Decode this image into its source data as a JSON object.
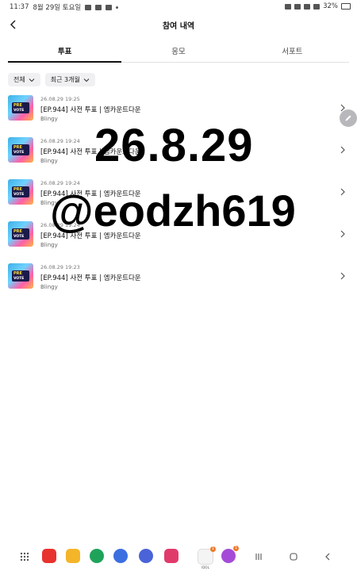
{
  "status_bar": {
    "time": "11:37",
    "date": "8월 29일 토요일",
    "battery": "32%"
  },
  "header": {
    "title": "참여 내역"
  },
  "tabs": [
    {
      "label": "투표",
      "active": true
    },
    {
      "label": "응모",
      "active": false
    },
    {
      "label": "서포트",
      "active": false
    }
  ],
  "filters": {
    "type": "전체",
    "period": "최근 3개월"
  },
  "items": [
    {
      "date": "26.08.29 19:25",
      "title": "[EP.944] 사전 투표 | 엠카운트다운",
      "source": "Blingy",
      "thumb_top": "PRE",
      "thumb_bottom": "VOTE"
    },
    {
      "date": "26.08.29 19:24",
      "title": "[EP.944] 사전 투표 | 엠카운트다운",
      "source": "Blingy",
      "thumb_top": "PRE",
      "thumb_bottom": "VOTE"
    },
    {
      "date": "26.08.29 19:24",
      "title": "[EP.944] 사전 투표 | 엠카운트다운",
      "source": "Blingy",
      "thumb_top": "PRE",
      "thumb_bottom": "VOTE"
    },
    {
      "date": "26.08.29 19:24",
      "title": "[EP.944] 사전 투표 | 엠카운트다운",
      "source": "Blingy",
      "thumb_top": "PRE",
      "thumb_bottom": "VOTE"
    },
    {
      "date": "26.08.29 19:23",
      "title": "[EP.944] 사전 투표 | 엠카운트다운",
      "source": "Blingy",
      "thumb_top": "PRE",
      "thumb_bottom": "VOTE"
    }
  ],
  "overlay": {
    "date": "26.8.29",
    "handle": "@eodzh619"
  },
  "taskbar": {
    "apps": [
      {
        "name": "flipboard-app-icon",
        "color": "#e8322d"
      },
      {
        "name": "notes-app-icon",
        "color": "#f4b529"
      },
      {
        "name": "phone-app-icon",
        "color": "#1fa35a"
      },
      {
        "name": "messages-app-icon",
        "color": "#3b6fe0"
      },
      {
        "name": "internet-app-icon",
        "color": "#4a63d8"
      },
      {
        "name": "camera-app-icon",
        "color": "#e03a6a"
      },
      {
        "name": "idol-app-icon",
        "color": "#f4f4f4",
        "label": "IDOL",
        "badge": "1"
      },
      {
        "name": "m-app-icon",
        "color": "#a54bd8",
        "badge": "1"
      }
    ]
  },
  "colors": {
    "accent": "#111111",
    "chip_bg": "#f0f0f2",
    "badge": "#f07a2a"
  }
}
